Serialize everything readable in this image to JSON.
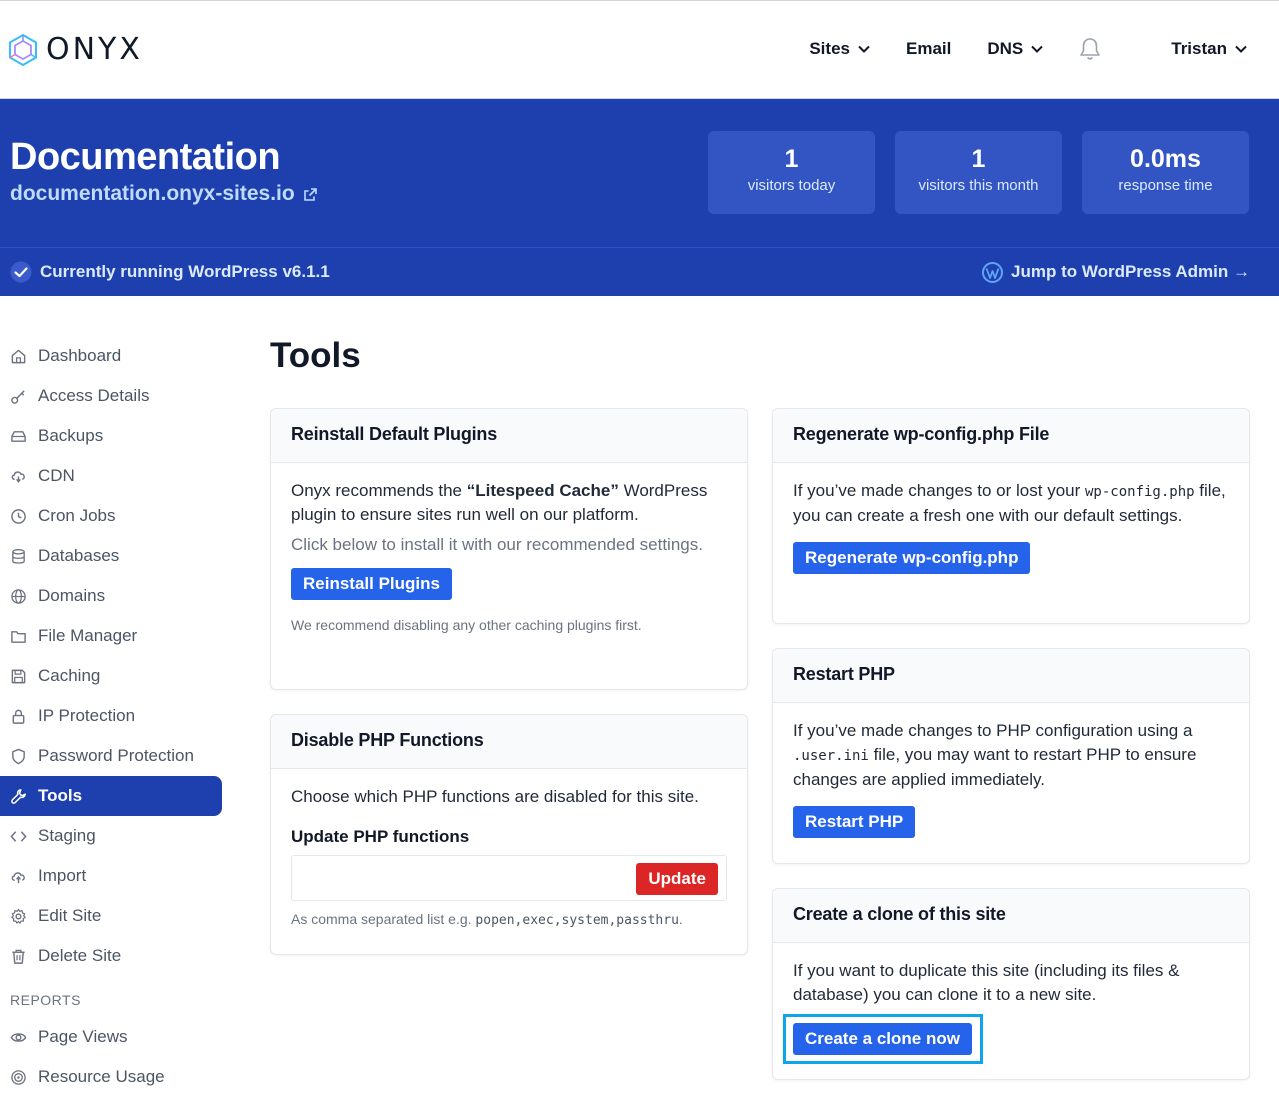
{
  "brand": {
    "name": "ONYX"
  },
  "nav": {
    "sites": "Sites",
    "email": "Email",
    "dns": "DNS",
    "user": "Tristan"
  },
  "site": {
    "title": "Documentation",
    "url": "documentation.onyx-sites.io",
    "wp_status": "Currently running WordPress v6.1.1",
    "wp_admin_link": "Jump to WordPress Admin →"
  },
  "stats": [
    {
      "value": "1",
      "label": "visitors today"
    },
    {
      "value": "1",
      "label": "visitors this month"
    },
    {
      "value": "0.0ms",
      "label": "response time"
    }
  ],
  "sidebar": {
    "items": [
      {
        "label": "Dashboard",
        "icon": "home-icon"
      },
      {
        "label": "Access Details",
        "icon": "key-icon"
      },
      {
        "label": "Backups",
        "icon": "drive-icon"
      },
      {
        "label": "CDN",
        "icon": "cloud-download-icon"
      },
      {
        "label": "Cron Jobs",
        "icon": "clock-icon"
      },
      {
        "label": "Databases",
        "icon": "database-icon"
      },
      {
        "label": "Domains",
        "icon": "globe-icon"
      },
      {
        "label": "File Manager",
        "icon": "folder-icon"
      },
      {
        "label": "Caching",
        "icon": "save-icon"
      },
      {
        "label": "IP Protection",
        "icon": "lock-icon"
      },
      {
        "label": "Password Protection",
        "icon": "shield-icon"
      },
      {
        "label": "Tools",
        "icon": "wrench-icon",
        "active": true
      },
      {
        "label": "Staging",
        "icon": "code-icon"
      },
      {
        "label": "Import",
        "icon": "cloud-upload-icon"
      },
      {
        "label": "Edit Site",
        "icon": "gear-icon"
      },
      {
        "label": "Delete Site",
        "icon": "trash-icon"
      }
    ],
    "reports_heading": "REPORTS",
    "reports": [
      {
        "label": "Page Views",
        "icon": "eye-icon"
      },
      {
        "label": "Resource Usage",
        "icon": "target-icon"
      }
    ]
  },
  "main": {
    "title": "Tools",
    "reinstall": {
      "heading": "Reinstall Default Plugins",
      "text_before": "Onyx recommends the ",
      "text_strong": "“Litespeed Cache”",
      "text_after": " WordPress plugin to ensure sites run well on our platform.",
      "hint": "Click below to install it with our recommended settings.",
      "button": "Reinstall Plugins",
      "note": "We recommend disabling any other caching plugins first."
    },
    "disable_php": {
      "heading": "Disable PHP Functions",
      "text": "Choose which PHP functions are disabled for this site.",
      "field_label": "Update PHP functions",
      "input_value": "",
      "button": "Update",
      "help_prefix": "As comma separated list e.g. ",
      "help_code": "popen,exec,system,passthru",
      "help_suffix": "."
    },
    "regenerate": {
      "heading": "Regenerate wp-config.php File",
      "text_before": "If you’ve made changes to or lost your ",
      "text_code": "wp-config.php",
      "text_after": " file, you can create a fresh one with our default settings.",
      "button": "Regenerate wp-config.php"
    },
    "restart_php": {
      "heading": "Restart PHP",
      "text_before": "If you’ve made changes to PHP configuration using a ",
      "text_code": ".user.ini",
      "text_after": " file, you may want to restart PHP to ensure changes are applied immediately.",
      "button": "Restart PHP"
    },
    "clone": {
      "heading": "Create a clone of this site",
      "text": "If you want to duplicate this site (including its files & database) you can clone it to a new site.",
      "button": "Create a clone now"
    }
  },
  "colors": {
    "brand_blue": "#1e40af",
    "button_blue": "#2563eb",
    "danger_red": "#dc2626",
    "highlight": "#0ea5e9"
  }
}
